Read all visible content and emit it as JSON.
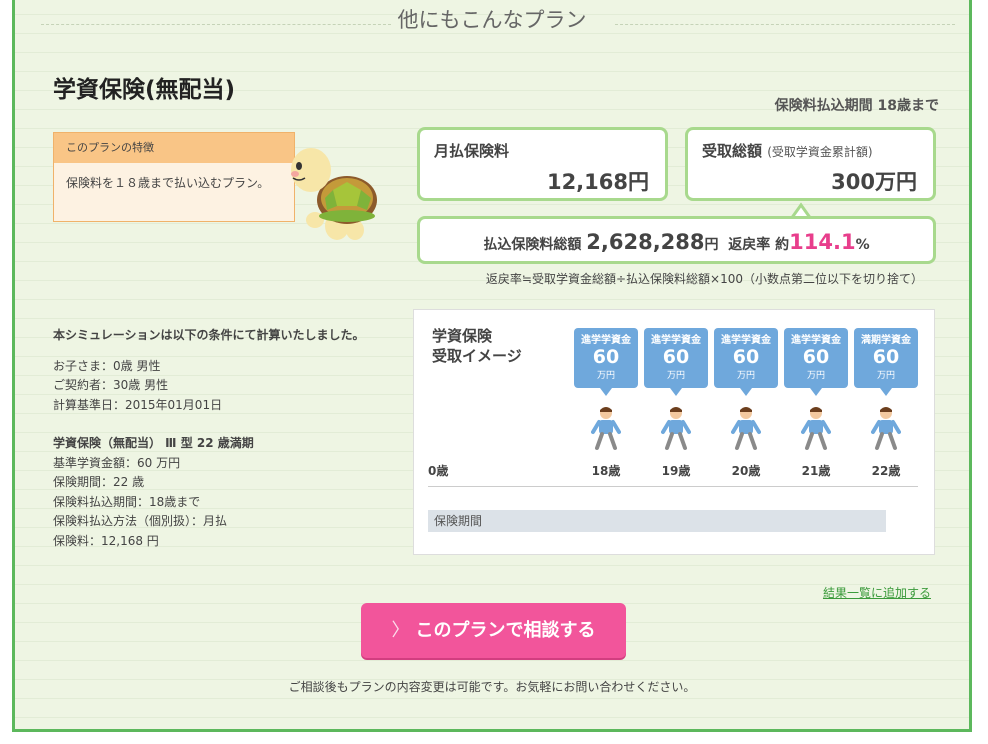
{
  "section_title": "他にもこんなプラン",
  "plan": {
    "name": "学資保険(無配当)",
    "pay_period": "保険料払込期間 18歳まで"
  },
  "feature": {
    "header": "このプランの特徴",
    "body": "保険料を１８歳まで払い込むプラン。"
  },
  "summary": {
    "monthly_label": "月払保険料",
    "monthly_value": "12,168円",
    "total_label": "受取総額",
    "total_sub": "(受取学資金累計額)",
    "total_value": "300万円",
    "payment_label": "払込保険料総額",
    "payment_value": "2,628,288",
    "payment_unit": "円",
    "return_label": "返戻率",
    "return_prefix": "約",
    "return_value": "114.1",
    "return_unit": "%",
    "formula": "返戻率≒受取学資金総額÷払込保険料総額×100（小数点第二位以下を切り捨て）"
  },
  "conditions": {
    "heading": "本シミュレーションは以下の条件にて計算いたしました。",
    "group1": [
      "お子さま：0歳 男性",
      "ご契約者：30歳 男性",
      "計算基準日：2015年01月01日"
    ],
    "group2_title": "学資保険（無配当） Ⅲ 型 22 歳満期",
    "group2": [
      "基準学資金額：60 万円",
      "保険期間：22 歳",
      "保険料払込期間：18歳まで",
      "保険料払込方法（個別扱）：月払",
      "保険料：12,168 円"
    ]
  },
  "chart": {
    "title_line1": "学資保険",
    "title_line2": "受取イメージ",
    "start_age": "0歳",
    "period_label": "保険期間",
    "payouts": [
      {
        "type": "進学学資金",
        "amount": "60",
        "unit": "万円",
        "age": "18歳"
      },
      {
        "type": "進学学資金",
        "amount": "60",
        "unit": "万円",
        "age": "19歳"
      },
      {
        "type": "進学学資金",
        "amount": "60",
        "unit": "万円",
        "age": "20歳"
      },
      {
        "type": "進学学資金",
        "amount": "60",
        "unit": "万円",
        "age": "21歳"
      },
      {
        "type": "満期学資金",
        "amount": "60",
        "unit": "万円",
        "age": "22歳"
      }
    ]
  },
  "actions": {
    "add_link": "結果一覧に追加する",
    "consult_chevron": "〉",
    "consult_button": "このプランで相談する",
    "note": "ご相談後もプランの内容変更は可能です。お気軽にお問い合わせください。"
  },
  "colors": {
    "accent_green": "#5cb85c",
    "pink": "#f2559b",
    "bubble_blue": "#6fa8dc"
  }
}
